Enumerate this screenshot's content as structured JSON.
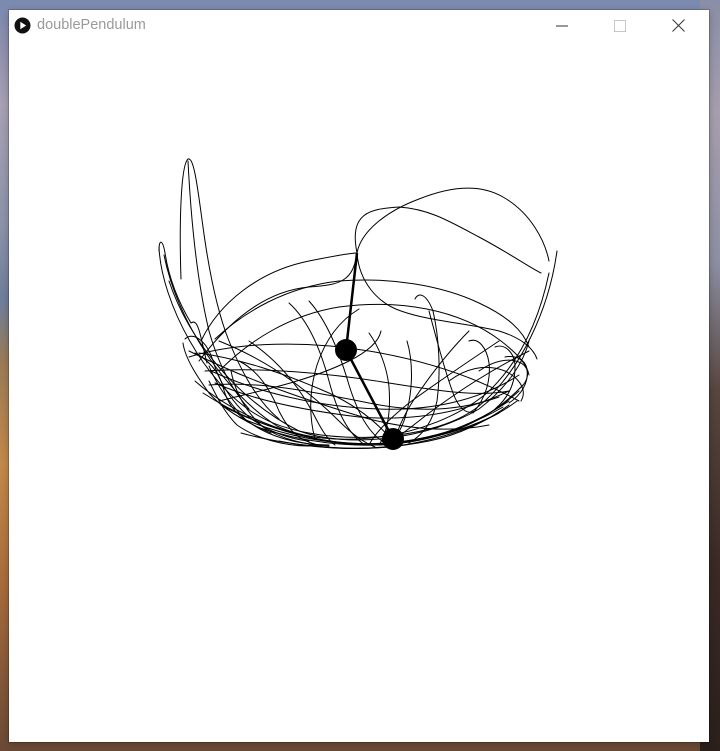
{
  "window": {
    "title": "doublePendulum",
    "app_icon": "processing-play-icon",
    "controls": [
      "minimize-icon",
      "maximize-icon",
      "close-icon"
    ]
  },
  "colors": {
    "background": "#ffffff",
    "trace": "#000000",
    "title_text": "#9a9a9a"
  }
}
